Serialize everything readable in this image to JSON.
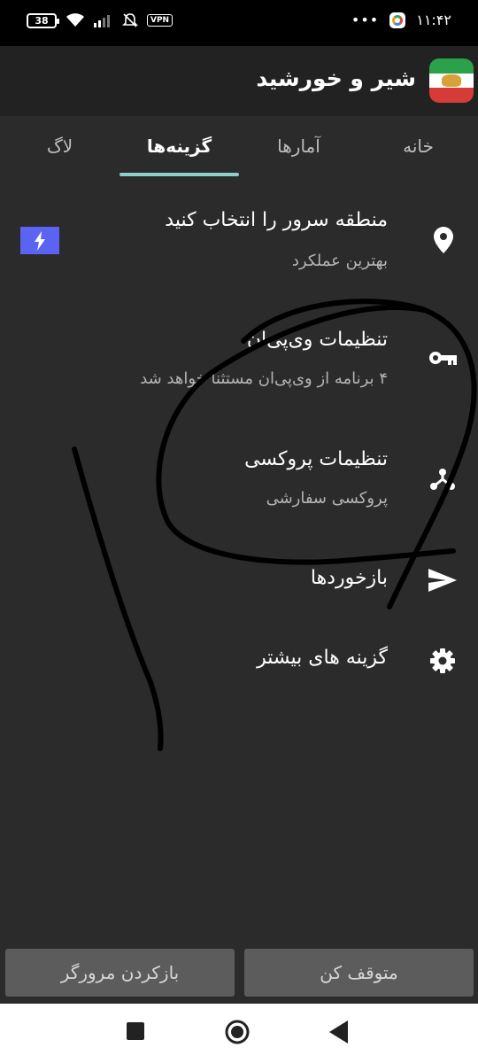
{
  "status_bar": {
    "battery": "38",
    "vpn_label": "VPN",
    "overflow_dots": "•••",
    "time": "۱۱:۴۲",
    "icons": [
      "battery-icon",
      "wifi-icon",
      "signal-icon",
      "notifications-off-icon",
      "vpn-icon",
      "app-notification-icon"
    ]
  },
  "app_bar": {
    "title": "شیر و خورشید",
    "logo": "lion-and-sun-flag-logo"
  },
  "tabs": [
    {
      "label": "خانه",
      "active": false
    },
    {
      "label": "آمارها",
      "active": false
    },
    {
      "label": "گزینه‌ها",
      "active": true
    },
    {
      "label": "لاگ",
      "active": false
    }
  ],
  "options": [
    {
      "title": "منطقه سرور را انتخاب کنید",
      "subtitle": "بهترین عملکرد",
      "icon": "location-pin-icon",
      "badge_icon": "bolt-icon"
    },
    {
      "title": "تنظیمات وی‌پی‌ان",
      "subtitle": "۴ برنامه از وی‌پی‌ان مستثنا خواهد شد",
      "icon": "key-icon"
    },
    {
      "title": "تنظیمات پروکسی",
      "subtitle": "پروکسی سفارشی",
      "icon": "proxy-hub-icon"
    },
    {
      "title": "بازخوردها",
      "icon": "send-icon"
    },
    {
      "title": "گزینه های بیشتر",
      "icon": "gear-icon"
    }
  ],
  "buttons": {
    "open_browser": "بازکردن مرورگر",
    "stop": "متوقف کن"
  },
  "nav_bar": {
    "icons": [
      "recents-square-icon",
      "home-circle-icon",
      "back-triangle-icon"
    ]
  },
  "colors": {
    "background": "#2b2b2b",
    "app_bar": "#222222",
    "tab_indicator": "#8ad0c8",
    "badge": "#5b63f2",
    "button": "#5c5c5c"
  }
}
